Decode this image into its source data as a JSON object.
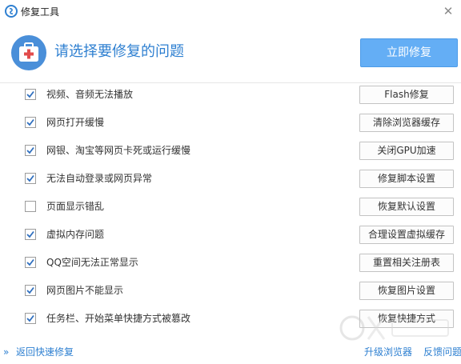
{
  "window": {
    "title": "修复工具",
    "close_glyph": "✕"
  },
  "header": {
    "prompt": "请选择要修复的问题",
    "repair_button": "立即修复"
  },
  "colors": {
    "accent": "#2f80d1",
    "primary_button": "#64aef5",
    "kit_icon": "#4a8fd9",
    "cross": "#e24c4c"
  },
  "icons": {
    "app_logo": "app-logo-icon",
    "kit": "medical-kit-icon",
    "checkmark": "checkmark-icon",
    "back": "double-chevron-icon"
  },
  "issues": [
    {
      "label": "视频、音频无法播放",
      "action": "Flash修复",
      "checked": true
    },
    {
      "label": "网页打开缓慢",
      "action": "清除浏览器缓存",
      "checked": true
    },
    {
      "label": "网银、淘宝等网页卡死或运行缓慢",
      "action": "关闭GPU加速",
      "checked": true
    },
    {
      "label": "无法自动登录或网页异常",
      "action": "修复脚本设置",
      "checked": true
    },
    {
      "label": "页面显示错乱",
      "action": "恢复默认设置",
      "checked": false
    },
    {
      "label": "虚拟内存问题",
      "action": "合理设置虚拟缓存",
      "checked": true
    },
    {
      "label": "QQ空间无法正常显示",
      "action": "重置相关注册表",
      "checked": true
    },
    {
      "label": "网页图片不能显示",
      "action": "恢复图片设置",
      "checked": true
    },
    {
      "label": "任务栏、开始菜单快捷方式被篡改",
      "action": "恢复快捷方式",
      "checked": true
    }
  ],
  "footer": {
    "back_chevrons": "»",
    "back_link": "返回快速修复",
    "upgrade_link": "升级浏览器",
    "feedback_link": "反馈问题"
  }
}
